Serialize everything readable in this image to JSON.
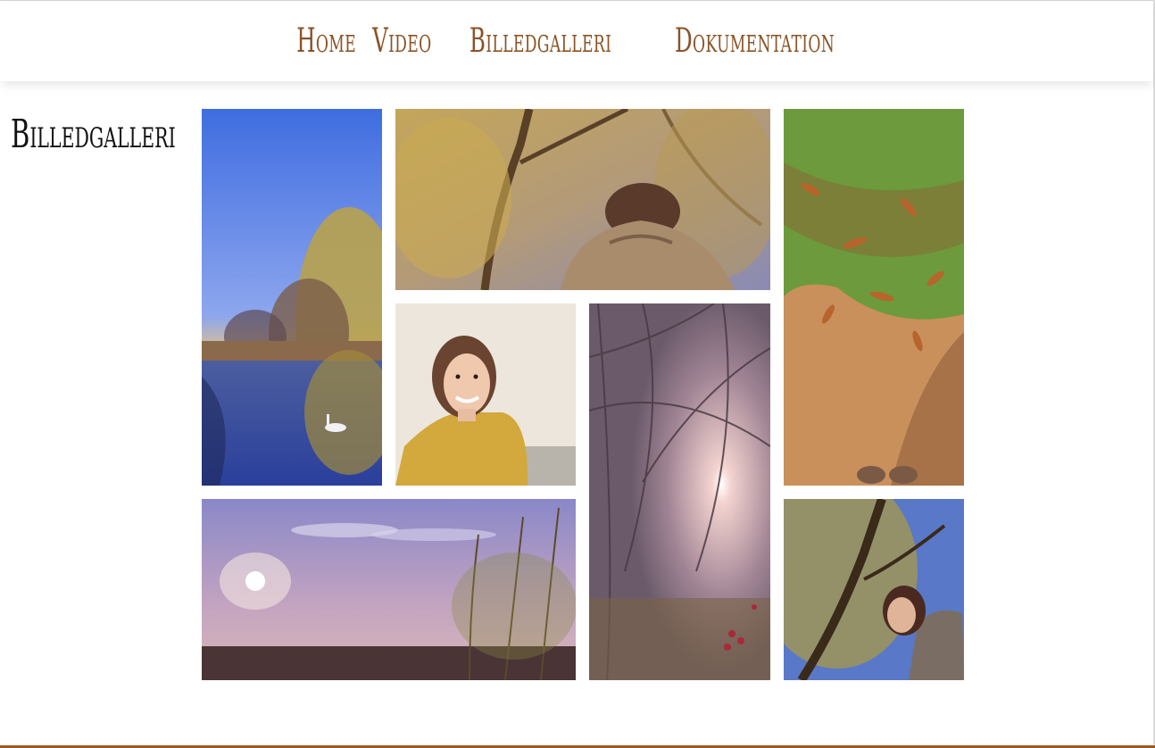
{
  "nav": {
    "items": [
      {
        "label": "Home"
      },
      {
        "label": "Video"
      },
      {
        "label": "Billedgalleri"
      },
      {
        "label": "Dokumentation"
      }
    ]
  },
  "page": {
    "title": "Billedgalleri"
  },
  "colors": {
    "nav_text": "#8a5326",
    "footer_line": "#9a5a22",
    "title_text": "#111111"
  },
  "gallery": {
    "photos": [
      {
        "subject": "lake-with-swan"
      },
      {
        "subject": "person-under-willow"
      },
      {
        "subject": "autumn-leaves-ground"
      },
      {
        "subject": "smiling-portrait"
      },
      {
        "subject": "sun-through-branches"
      },
      {
        "subject": "sunset-sky"
      },
      {
        "subject": "person-in-tree"
      }
    ]
  }
}
